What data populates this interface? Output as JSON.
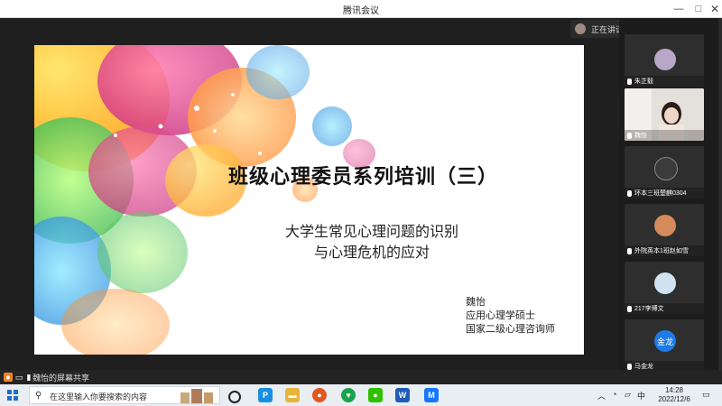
{
  "window": {
    "title": "腾讯会议",
    "minimize": "—",
    "maximize": "□",
    "close": "✕"
  },
  "slide": {
    "title": "班级心理委员系列培训（三）",
    "subtitle_line1": "大学生常见心理问题的识别",
    "subtitle_line2": "与心理危机的应对",
    "author": "魏怡",
    "author_title1": "应用心理学硕士",
    "author_title2": "国家二级心理咨询师"
  },
  "speaking": {
    "label": "正在讲话:"
  },
  "participants": [
    {
      "name": "朱芷毅",
      "avatar_color": "#b9a7c8"
    },
    {
      "name": "魏怡",
      "avatar_color": "#e8d9cf"
    },
    {
      "name": "环本三班楚麒0304",
      "avatar_color": "#3b3b3b"
    },
    {
      "name": "外院英本1班赵如雪",
      "avatar_color": "#d48a5a"
    },
    {
      "name": "217李博文",
      "avatar_color": "#cfe3f2"
    },
    {
      "name": "马金龙",
      "avatar_text": "金龙",
      "avatar_color": "#1e7ae6"
    }
  ],
  "sharebar": {
    "label": "魏怡的屏幕共享"
  },
  "taskbar": {
    "search_placeholder": "在这里输入你要搜索的内容",
    "tray_lang": "中",
    "time": "14:28",
    "date": "2022/12/6"
  }
}
